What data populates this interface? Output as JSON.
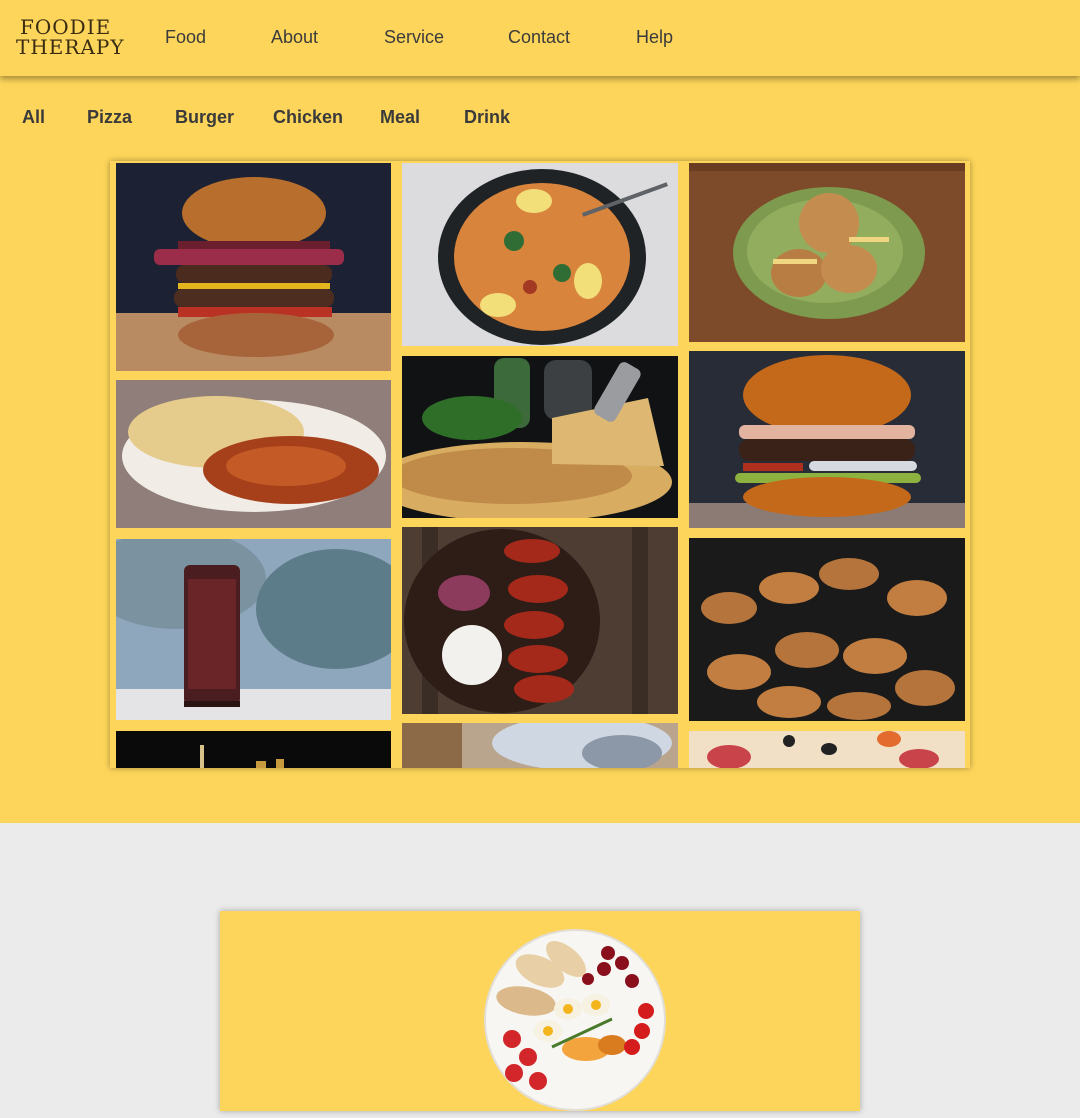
{
  "brand": {
    "line1": "FOODIE",
    "line2": "THERAPY"
  },
  "nav": {
    "items": [
      {
        "label": "Food"
      },
      {
        "label": "About"
      },
      {
        "label": "Service"
      },
      {
        "label": "Contact"
      },
      {
        "label": "Help"
      }
    ]
  },
  "filters": {
    "items": [
      {
        "label": "All"
      },
      {
        "label": "Pizza"
      },
      {
        "label": "Burger"
      },
      {
        "label": "Chicken"
      },
      {
        "label": "Meal"
      },
      {
        "label": "Drink"
      }
    ]
  },
  "gallery": {
    "images": [
      "stacked-burger-photo",
      "paella-pan-photo",
      "fried-chicken-plate-photo",
      "curry-naan-photo",
      "pizza-slice-photo",
      "cheeseburger-photo",
      "cola-can-photo",
      "glazed-wings-photo",
      "grilled-drumsticks-photo",
      "fries-photo",
      "dish-partial-photo",
      "pepperoni-pizza-photo"
    ]
  },
  "colors": {
    "accent": "#fdd55a",
    "page_background": "#ebebeb",
    "text": "#3b3b3b"
  }
}
